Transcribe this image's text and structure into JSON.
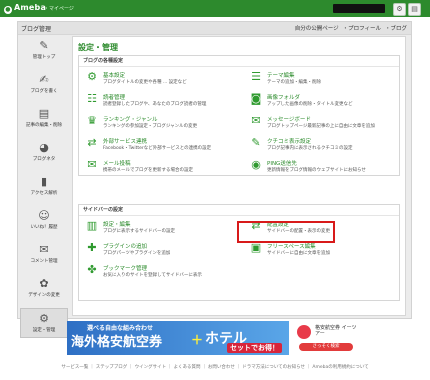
{
  "topbar": {
    "logo_text": "Ameba",
    "mypage": "・マイページ"
  },
  "blogbar": {
    "title": "ブログ管理",
    "links": [
      "自分の公開ページ",
      "・プロフィール",
      "・ブログ"
    ]
  },
  "sidebar": {
    "items": [
      {
        "label": "管理トップ",
        "icon": "pencil-icon"
      },
      {
        "label": "ブログを書く",
        "icon": "edit-icon"
      },
      {
        "label": "記事の編集・削除",
        "icon": "document-icon"
      },
      {
        "label": "ブログネタ",
        "icon": "pig-icon"
      },
      {
        "label": "アクセス解析",
        "icon": "bar-chart-icon"
      },
      {
        "label": "いいね！履歴",
        "icon": "smile-icon"
      },
      {
        "label": "コメント管理",
        "icon": "comment-icon"
      },
      {
        "label": "デザインの変更",
        "icon": "palette-icon"
      },
      {
        "label": "設定・管理",
        "icon": "gear-icon",
        "active": true
      }
    ]
  },
  "main": {
    "title": "設定・管理",
    "sections": [
      {
        "heading": "ブログの各種設定",
        "items": [
          {
            "label": "基本設定",
            "desc": "ブログタイトルの変更や各種 ... 設定など",
            "icon": "gear-icon"
          },
          {
            "label": "テーマ編集",
            "desc": "テーマの追加・編集・削除",
            "icon": "list-icon"
          },
          {
            "label": "読者管理",
            "desc": "読者登録したブログや、あなたのブログ読者の管理",
            "icon": "readers-icon"
          },
          {
            "label": "画像フォルダ",
            "desc": "アップした画像の削除・タイトル変更など",
            "icon": "camera-icon"
          },
          {
            "label": "ランキング・ジャンル",
            "desc": "ランキングの参加設定・ブログジャンルの変更",
            "icon": "ranking-icon"
          },
          {
            "label": "メッセージボード",
            "desc": "ブログトップページ最新記事の上に自由に文章を追加",
            "icon": "message-icon"
          },
          {
            "label": "外部サービス連携",
            "desc": "Facebook・Twitterなど外部サービスとの連携の設定",
            "icon": "link-icon"
          },
          {
            "label": "クチコミ表示設定",
            "desc": "ブログ記事内に表示されるクチコミの設定",
            "icon": "review-icon"
          },
          {
            "label": "メール投稿",
            "desc": "携帯のメールでブログを更新する場合の設定",
            "icon": "mail-icon"
          },
          {
            "label": "PING送信先",
            "desc": "更新情報をブログ情報のウェブサイトにお知らせ",
            "icon": "ping-icon"
          }
        ]
      },
      {
        "heading": "サイドバーの設定",
        "items": [
          {
            "label": "設定・編集",
            "desc": "ブログに表示するサイドバーの設定",
            "icon": "sidebar-settings-icon"
          },
          {
            "label": "配置設定",
            "desc": "サイドバーの配置・表示の変更",
            "icon": "arrange-icon"
          },
          {
            "label": "プラグインの追加",
            "desc": "ブログパーツやプラグインを追加",
            "icon": "plugin-add-icon"
          },
          {
            "label": "フリースペース編集",
            "desc": "サイドバーに自由に文章を追加",
            "icon": "freespace-icon"
          },
          {
            "label": "ブックマーク管理",
            "desc": "お気に入りのサイトを登録してサイドバーに表示",
            "icon": "puzzle-icon"
          }
        ]
      }
    ]
  },
  "banner": {
    "top_text": "選べる自由な組み合わせ",
    "big_text": "海外格安航空券",
    "plus": "＋",
    "hotel": "ホテル",
    "red_label": "セットでお得！",
    "brand": "格安航空券 イーツアー",
    "button": "さっそく検索"
  },
  "footer": {
    "links": [
      "サービス一覧",
      "ステップブログ",
      "ウイングサイト",
      "よくある質問",
      "お問い合わせ",
      "ドラマ方法についてのお知らせ",
      "Amebaの利用規約について"
    ]
  }
}
